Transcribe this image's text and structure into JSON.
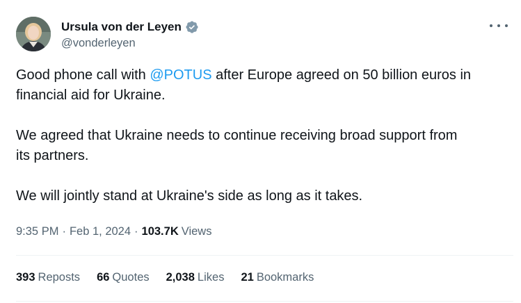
{
  "author": {
    "display_name": "Ursula von der Leyen",
    "handle": "@vonderleyen",
    "verified_icon": "verified-badge-icon",
    "verified_color": "#829aab"
  },
  "tweet": {
    "line1_before": "Good phone call with ",
    "mention": "@POTUS",
    "line1_after": " after Europe agreed on 50 billion euros in",
    "line2": "financial aid for Ukraine.",
    "line3": "We agreed that Ukraine needs to continue receiving broad support from",
    "line4": "its partners.",
    "line5": "We will jointly stand at Ukraine's side as long as it takes."
  },
  "meta": {
    "time": "9:35 PM",
    "separator": "·",
    "date": "Feb 1, 2024",
    "views_count": "103.7K",
    "views_label": "Views"
  },
  "stats": {
    "reposts_count": "393",
    "reposts_label": "Reposts",
    "quotes_count": "66",
    "quotes_label": "Quotes",
    "likes_count": "2,038",
    "likes_label": "Likes",
    "bookmarks_count": "21",
    "bookmarks_label": "Bookmarks"
  },
  "colors": {
    "text": "#0f1419",
    "secondary": "#536471",
    "link": "#1d9bf0",
    "divider": "#eff3f4"
  }
}
